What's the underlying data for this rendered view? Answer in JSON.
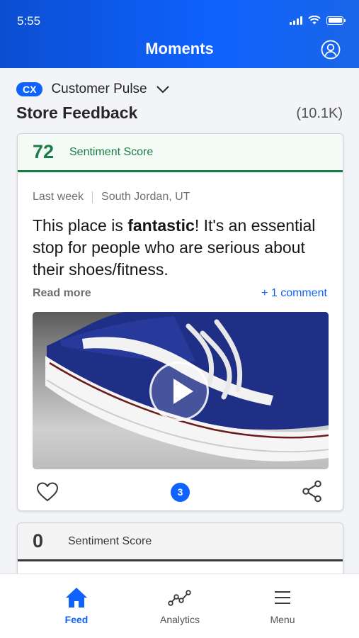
{
  "status_bar": {
    "time": "5:55"
  },
  "header": {
    "title": "Moments",
    "profile_icon": "user-profile-icon"
  },
  "selector": {
    "badge": "CX",
    "label": "Customer Pulse",
    "icon": "chevron-down-icon"
  },
  "section": {
    "title": "Store Feedback",
    "count": "(10.1K)"
  },
  "cards": [
    {
      "score": "72",
      "score_label": "Sentiment Score",
      "time": "Last week",
      "location": "South Jordan, UT",
      "review_before": "This place is ",
      "review_bold": "fantastic",
      "review_after": "! It's an essential stop for people who are serious about their shoes/fitness.",
      "read_more": "Read more",
      "comment_link": "+ 1 comment",
      "media": "shoe-video-thumbnail",
      "count": "3"
    },
    {
      "score": "0",
      "score_label": "Sentiment Score"
    }
  ],
  "nav": [
    {
      "label": "Feed",
      "icon": "home-icon",
      "active": true
    },
    {
      "label": "Analytics",
      "icon": "analytics-icon",
      "active": false
    },
    {
      "label": "Menu",
      "icon": "menu-icon",
      "active": false
    }
  ],
  "colors": {
    "brand_blue": "#0f62fe",
    "positive_green": "#1b7d46",
    "neutral_dark": "#393939"
  }
}
